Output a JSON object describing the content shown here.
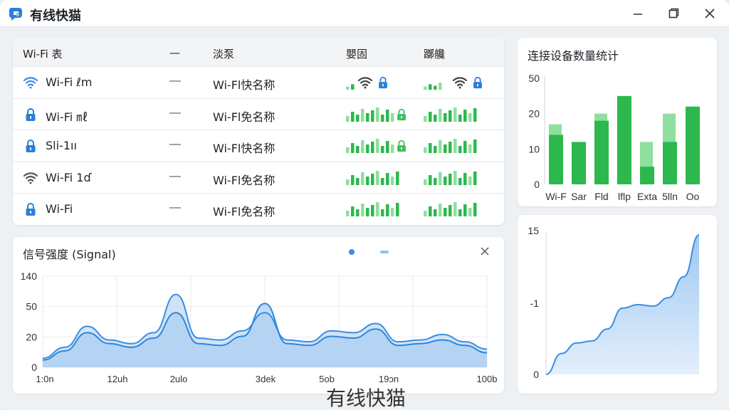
{
  "app": {
    "title": "有线快猫",
    "watermark": "有线快猫"
  },
  "window_controls": {
    "minimize_icon": "minimize-icon",
    "maximize_icon": "maximize-icon",
    "close_icon": "close-icon"
  },
  "wifi_table": {
    "headers": [
      "Wi-Fi 表",
      "—",
      "淡泵",
      "嬰固",
      "躑艬"
    ],
    "rows": [
      {
        "icon": "wifi-icon",
        "name": "Wi-Fi ℓm",
        "dash": "—",
        "desc": "Wi-Fl快名称",
        "lock1": true,
        "lock2": true,
        "signal1_level": 0.35,
        "signal2_level": 0.35
      },
      {
        "icon": "lock-icon",
        "name": "Wi-Fi ㎖",
        "dash": "—",
        "desc": "Wi-Fl免名称",
        "lock1": true,
        "lock2": false,
        "signal1_level": 0.8,
        "signal2_level": 0.8
      },
      {
        "icon": "lock-icon",
        "name": "Sli-1ıı",
        "dash": "—",
        "desc": "Wi-Fl快名称",
        "lock1": true,
        "lock2": false,
        "signal1_level": 0.8,
        "signal2_level": 0.8
      },
      {
        "icon": "wifi-icon",
        "name": "Wi-Fi 1ɗ",
        "dash": "—",
        "desc": "Wi-Fl免名称",
        "lock1": false,
        "lock2": false,
        "signal1_level": 0.8,
        "signal2_level": 0.8
      },
      {
        "icon": "lock-icon",
        "name": "Wi-Fi",
        "dash": "—",
        "desc": "Wi-Fl免名称",
        "lock1": false,
        "lock2": false,
        "signal1_level": 0.8,
        "signal2_level": 0.8
      }
    ]
  },
  "colors": {
    "accent": "#3a8ee6",
    "green": "#2db84d",
    "light_green": "#7fd98f",
    "area_fill": "#bcd9f5"
  },
  "chart_data": [
    {
      "type": "area",
      "title": "信号强度 (Signal)",
      "y_ticks": [
        "140",
        "50",
        "20",
        "0"
      ],
      "x_ticks": [
        "1:0n",
        "12uh",
        "2ulo",
        "3dek",
        "5ob",
        "19ɔn",
        "100b"
      ],
      "x": [
        0,
        10,
        20,
        30,
        40,
        50,
        60,
        70,
        80,
        90,
        100,
        110,
        120,
        130,
        140,
        150,
        160,
        170,
        180,
        190,
        200
      ],
      "series": [
        {
          "values": [
            10,
            22,
            45,
            30,
            26,
            38,
            80,
            32,
            30,
            40,
            60,
            30,
            28,
            40,
            38,
            48,
            28,
            30,
            36,
            28,
            20
          ]
        },
        {
          "values": [
            8,
            18,
            38,
            26,
            22,
            32,
            60,
            26,
            24,
            34,
            70,
            26,
            24,
            34,
            32,
            42,
            24,
            26,
            30,
            24,
            16
          ]
        }
      ]
    },
    {
      "type": "bar",
      "title": "连接设备数量统计",
      "y_ticks": [
        "50",
        "20",
        "10",
        "0"
      ],
      "categories": [
        "Wi-F",
        "Sar",
        "Fld",
        "lflp",
        "Exta",
        "5lln",
        "Oo"
      ],
      "series": [
        {
          "name": "",
          "values": [
            14,
            12,
            18,
            25,
            5,
            12,
            22
          ]
        },
        {
          "name": "",
          "values": [
            17,
            0,
            20,
            0,
            12,
            20,
            0
          ]
        }
      ],
      "ylim": [
        0,
        30
      ]
    },
    {
      "type": "area",
      "y_ticks": [
        "15",
        "-1",
        "0"
      ],
      "x": [
        0,
        1,
        2,
        3,
        4,
        5,
        6,
        7,
        8,
        9,
        10
      ],
      "values": [
        0,
        3,
        4.5,
        4.8,
        6.5,
        9.5,
        10,
        9.8,
        11,
        14,
        20
      ]
    }
  ]
}
